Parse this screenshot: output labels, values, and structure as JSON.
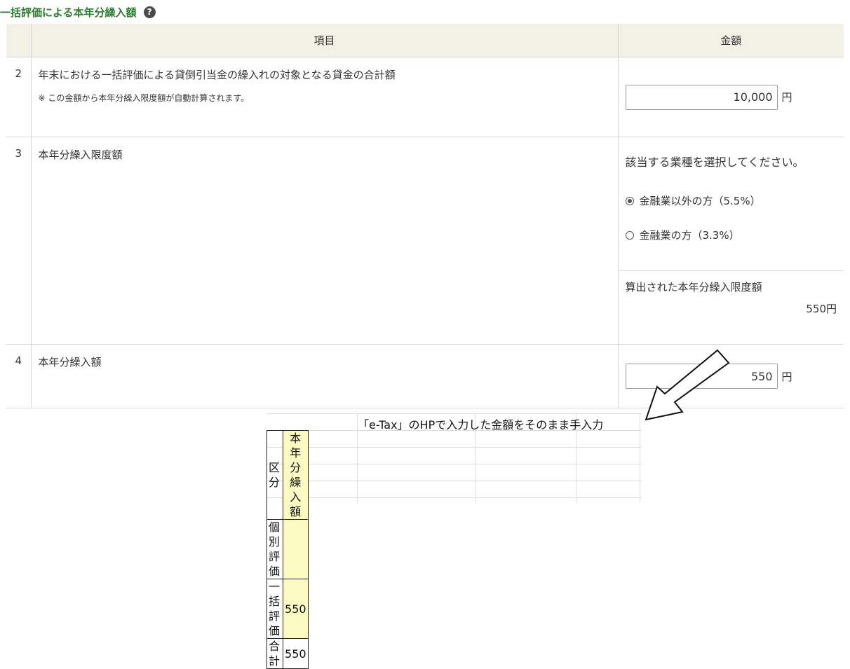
{
  "section": {
    "title": "一括評価による本年分繰入額",
    "help_icon": "question-circle-icon",
    "help_glyph": "?"
  },
  "table": {
    "headers": {
      "item": "項目",
      "amount": "金額"
    },
    "rows": [
      {
        "num": "2",
        "label": "年末における一括評価による貸倒引当金の繰入れの対象となる貸金の合計額",
        "note": "※ この金額から本年分繰入限度額が自動計算されます。",
        "value": "10,000",
        "unit": "円"
      },
      {
        "num": "3",
        "label": "本年分繰入限度額",
        "prompt": "該当する業種を選択してください。",
        "options": [
          {
            "label": "金融業以外の方（5.5%）",
            "selected": true
          },
          {
            "label": "金融業の方（3.3%）",
            "selected": false
          }
        ],
        "calc_label": "算出された本年分繰入限度額",
        "calc_value": "550円"
      },
      {
        "num": "4",
        "label": "本年分繰入額",
        "value": "550",
        "unit": "円"
      }
    ]
  },
  "annotation": {
    "arrow_icon": "arrow-down-left-icon",
    "note": "「e-Tax」のHPで入力した金額をそのまま手入力"
  },
  "spreadsheet": {
    "headers": [
      "区分",
      "本年分繰入額"
    ],
    "rows": [
      {
        "label": "個別評価",
        "value": ""
      },
      {
        "label": "一括評価",
        "value": "550"
      },
      {
        "label": "合計",
        "value": "550"
      }
    ]
  },
  "colors": {
    "title_green": "#2e7d32",
    "header_bg": "#f3f1e6",
    "cell_yellow": "#fdfbc4"
  }
}
